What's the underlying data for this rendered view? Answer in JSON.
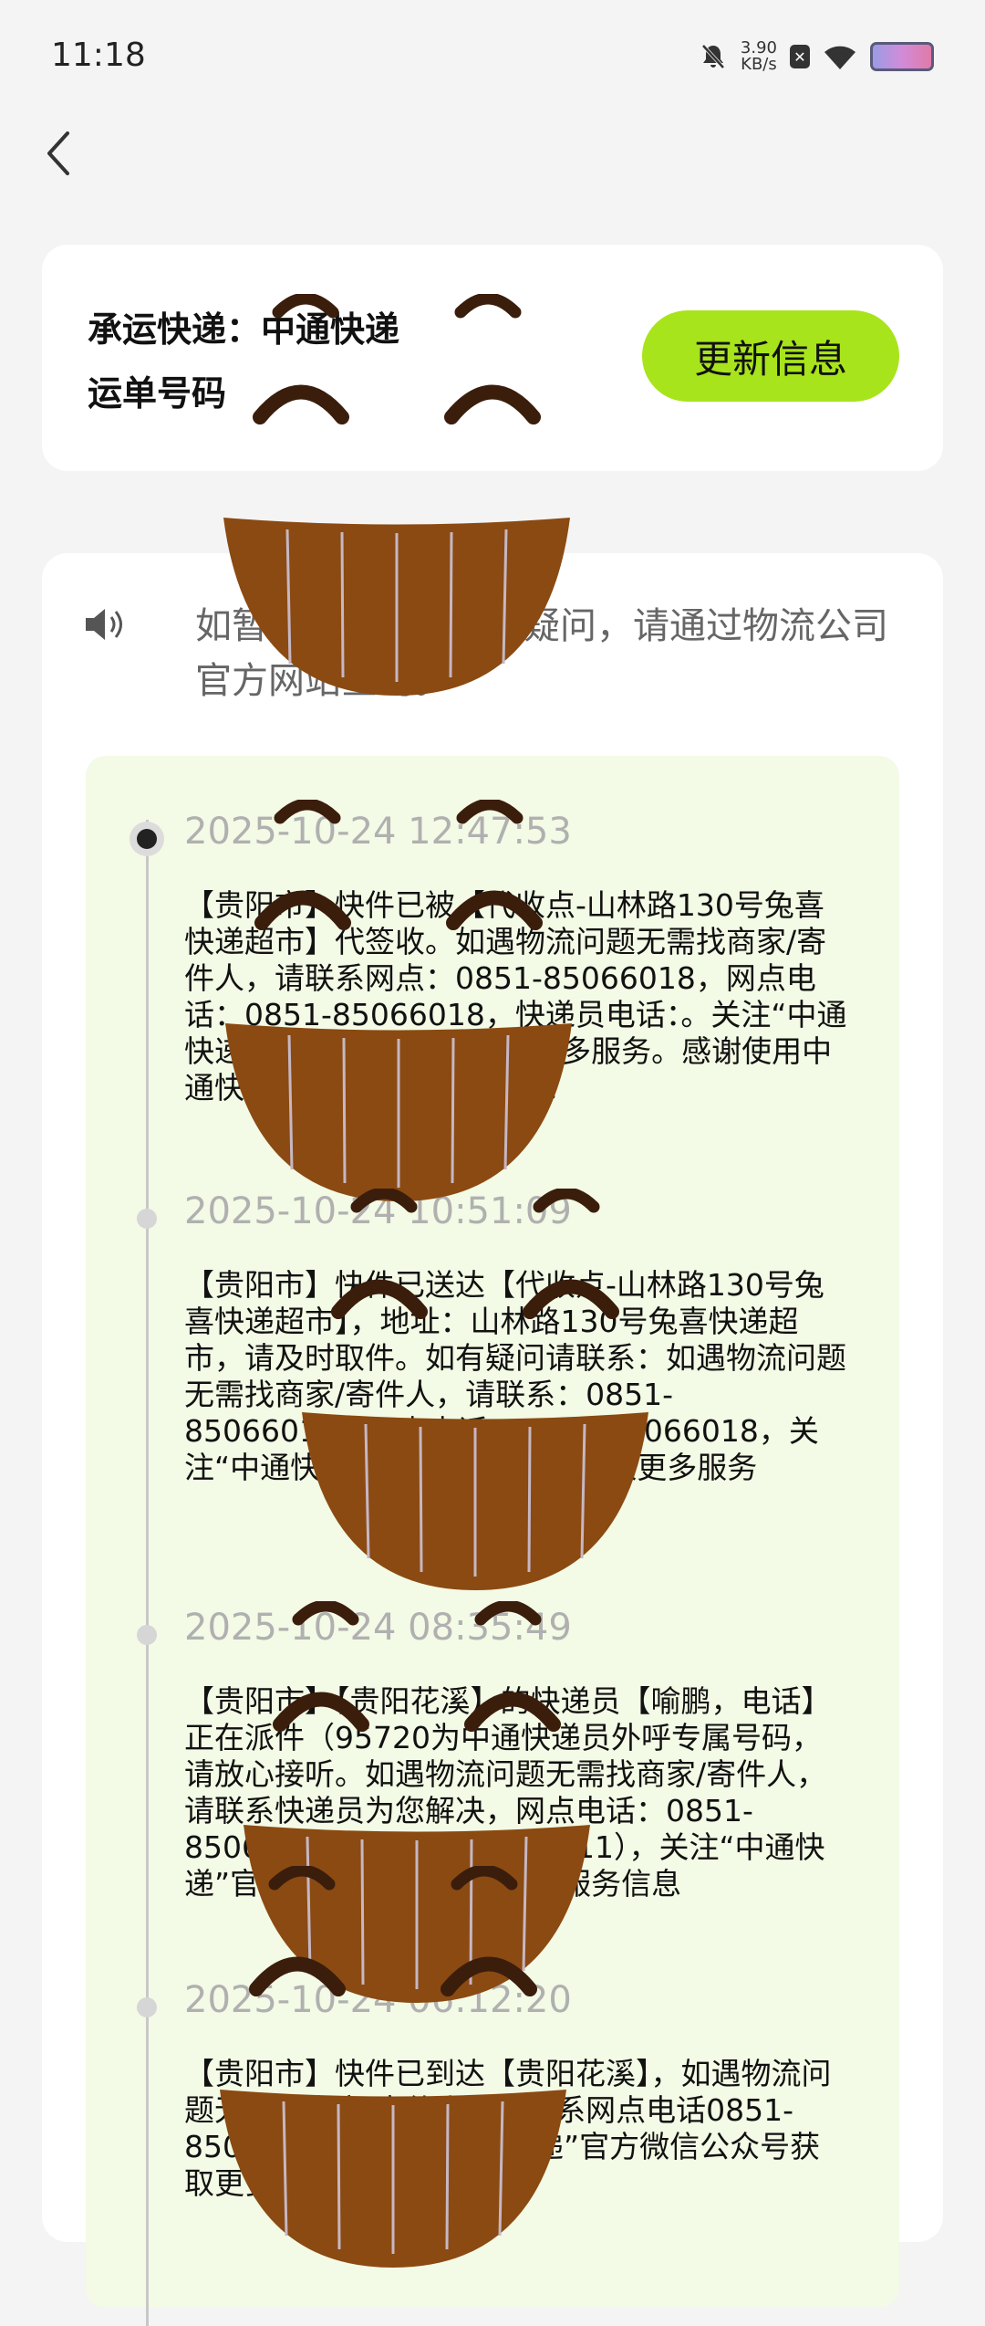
{
  "status": {
    "time": "11:18",
    "speed_value": "3.90",
    "speed_unit": "KB/s"
  },
  "carrier": {
    "label_company": "承运快递：中通快递",
    "label_tracking": "运单号码",
    "update_button": "更新信息"
  },
  "notice": {
    "text": "如暂无物流信息或有疑问，请通过物流公司官方网站查询。"
  },
  "events": [
    {
      "time": "2025-10-24 12:47:53",
      "desc": "【贵阳市】快件已被【代收点-山林路130号兔喜快递超市】代签收。如遇物流问题无需找商家/寄件人，请联系网点：0851-85066018，网点电话：0851-85066018，快递员电话：。关注“中通快递”官方微信公众号获取更多服务。感谢使用中通快递，期待再次为您服务！"
    },
    {
      "time": "2025-10-24 10:51:09",
      "desc": "【贵阳市】快件已送达【代收点-山林路130号兔喜快递超市】，地址：山林路130号兔喜快递超市，请及时取件。如有疑问请联系：如遇物流问题无需找商家/寄件人，请联系：0851-85066018，网点电话：0851-85066018，关注“中通快递”官方微信公众号获取更多服务"
    },
    {
      "time": "2025-10-24 08:35:49",
      "desc": "【贵阳市】【贵阳花溪】的快递员【喻鹏，电话】正在派件（95720为中通快递员外呼专属号码，请放心接听。如遇物流问题无需找商家/寄件人，请联系快递员为您解决，网点电话：0851-85066018，投诉电话：95311），关注“中通快递”官方微信公众号获取更多服务信息"
    },
    {
      "time": "2025-10-24 06:12:20",
      "desc": "【贵阳市】快件已到达【贵阳花溪】，如遇物流问题无需找商家/寄件人，请联系网点电话0851-85066018，关注“中通快递”官方微信公众号获取更多服务信息）"
    }
  ],
  "icons": {
    "back": "back-arrow-icon",
    "speaker": "speaker-icon",
    "emoji": "grinning-face-icon"
  },
  "colors": {
    "accent": "#a8e41b",
    "timeline_bg": "#f3fae5"
  }
}
